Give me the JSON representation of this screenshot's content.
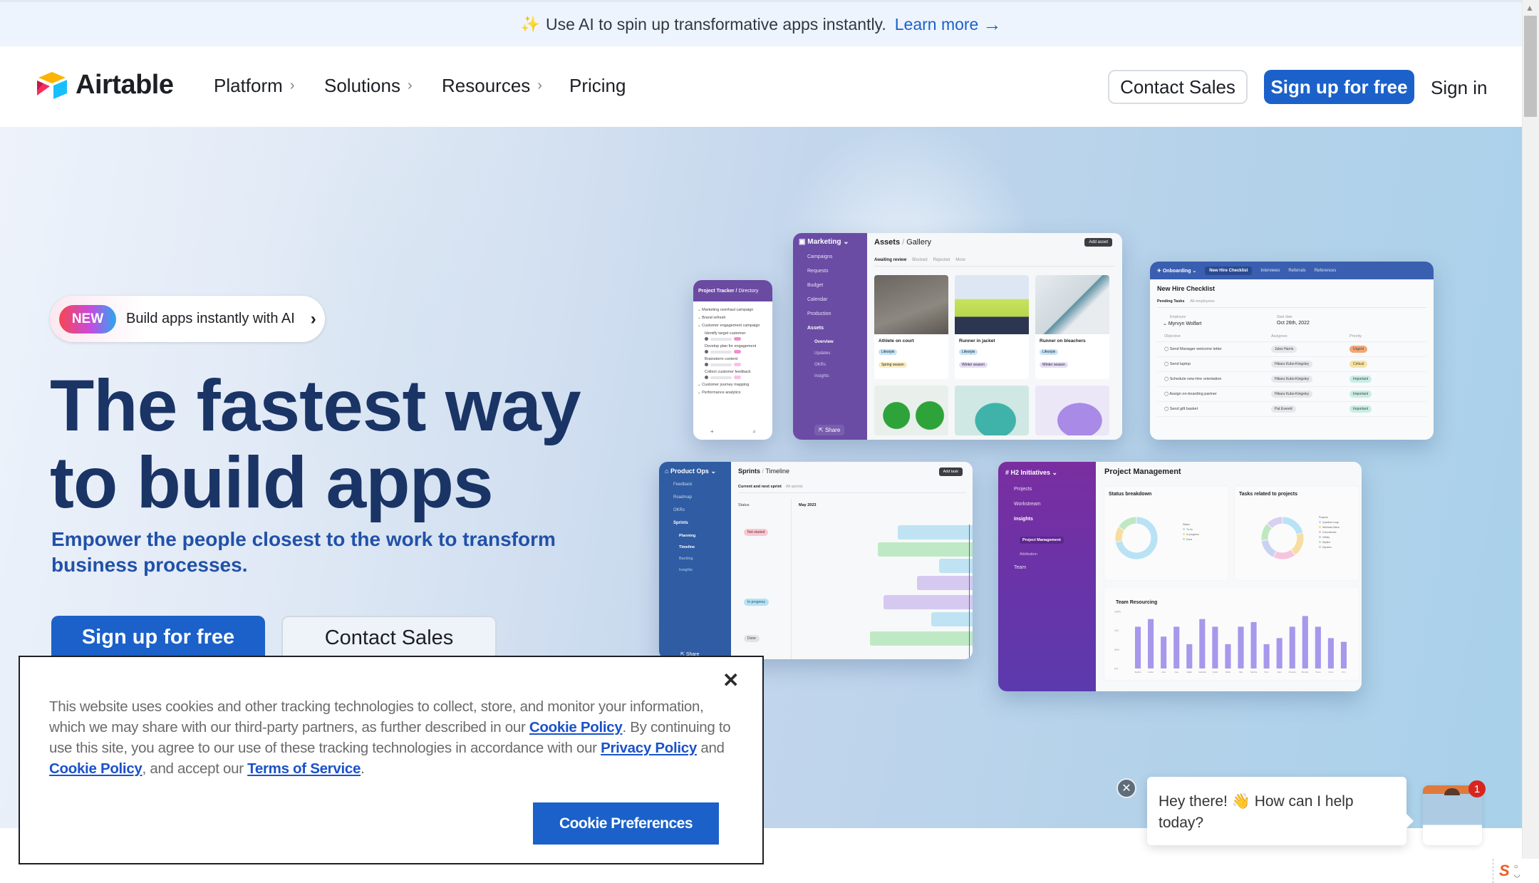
{
  "announcement": {
    "icon": "sparkles-icon",
    "text": "Use AI to spin up transformative apps instantly.",
    "link_label": "Learn more",
    "link_icon": "arrow-right-icon"
  },
  "nav": {
    "logo_text": "Airtable",
    "items": [
      {
        "label": "Platform",
        "has_chevron": true
      },
      {
        "label": "Solutions",
        "has_chevron": true
      },
      {
        "label": "Resources",
        "has_chevron": true
      },
      {
        "label": "Pricing",
        "has_chevron": false
      }
    ],
    "contact_sales": "Contact Sales",
    "sign_up": "Sign up for free",
    "sign_in": "Sign in"
  },
  "hero": {
    "badge": "NEW",
    "badge_text": "Build apps instantly with AI",
    "headline_line1": "The fastest way",
    "headline_line2": "to build apps",
    "subtitle": "Empower the people closest to the work to transform business processes.",
    "primary_cta": "Sign up for free",
    "secondary_cta": "Contact Sales"
  },
  "mockups": {
    "project_tracker": {
      "title": "Project Tracker",
      "subtitle": "Directory",
      "items": [
        "Marketing overhaul campaign",
        "Brand refresh",
        "Customer engagement campaign",
        "Identify target customer",
        "Develop plan for engagement",
        "Brainstorm content",
        "Collect customer feedback",
        "Customer journey mapping",
        "Performance analytics"
      ]
    },
    "marketing": {
      "app": "Marketing",
      "nav": [
        "Campaigns",
        "Requests",
        "Budget",
        "Calendar",
        "Production",
        "Assets"
      ],
      "subnav": [
        "Overview",
        "Updates",
        "OKRs",
        "Insights"
      ],
      "share": "Share",
      "crumb_a": "Assets",
      "crumb_b": "Gallery",
      "add_button": "Add asset",
      "tabs": [
        "Awaiting review",
        "Blocked",
        "Rejected",
        "More"
      ],
      "tiles": [
        {
          "name": "Athlete on court",
          "tag1": "Lifestyle",
          "tag2": "Spring season"
        },
        {
          "name": "Runner in jacket",
          "tag1": "Lifestyle",
          "tag2": "Winter season"
        },
        {
          "name": "Runner on bleachers",
          "tag1": "Lifestyle",
          "tag2": "Winter season"
        }
      ]
    },
    "onboarding": {
      "app": "Onboarding",
      "tabs": [
        "New Hire Checklist",
        "Interviews",
        "Referrals",
        "References"
      ],
      "title": "New Hire Checklist",
      "subtabs": [
        "Pending Tasks",
        "All employees"
      ],
      "employee_label": "Employee",
      "start_label": "Start date",
      "employee": "Myrvyn Wolfart",
      "start_date": "Oct 26th, 2022",
      "columns": [
        "Objective",
        "Assignee",
        "Priority"
      ],
      "rows": [
        {
          "objective": "Send Manager welcome letter",
          "assignee": "Jules Harris",
          "priority": "Urgent"
        },
        {
          "objective": "Send laptop",
          "assignee": "Hikaru Kubo-Kingsley",
          "priority": "Critical"
        },
        {
          "objective": "Schedule new-hire orientation",
          "assignee": "Hikaru Kubo-Kingsley",
          "priority": "Important"
        },
        {
          "objective": "Assign on-boarding partner",
          "assignee": "Hikaru Kubo-Kingsley",
          "priority": "Important"
        },
        {
          "objective": "Send gift basket",
          "assignee": "Pat Everett",
          "priority": "Important"
        }
      ],
      "priority_colors": {
        "Urgent": "#f3a676",
        "Critical": "#f8e3a1",
        "Important": "#c9ede5"
      }
    },
    "product_ops": {
      "app": "Product Ops",
      "nav": [
        "Feedback",
        "Roadmap",
        "OKRs",
        "Sprints"
      ],
      "subnav": [
        "Planning",
        "Timeline",
        "Backlog",
        "Insights"
      ],
      "share": "Share",
      "crumb_a": "Sprints",
      "crumb_b": "Timeline",
      "add_button": "Add task",
      "tabs": [
        "Current and next sprint",
        "All sprints"
      ],
      "status_label": "Status",
      "month": "May 2023",
      "groups": [
        "Not started",
        "In progress",
        "Done"
      ]
    },
    "h2": {
      "app": "H2 Initiatives",
      "nav": [
        "Projects",
        "Workstream",
        "Insights"
      ],
      "subnav": [
        "Project Management",
        "Attribution"
      ],
      "nav_last": "Team",
      "title": "Project Management",
      "panel1_title": "Status breakdown",
      "panel2_title": "Tasks related to projects",
      "panel3_title": "Team Resourcing"
    }
  },
  "chart_data": [
    {
      "type": "pie",
      "title": "Status breakdown",
      "legend_title": "Status",
      "labels": [
        "To do",
        "In progress",
        "Done"
      ],
      "values": [
        72,
        12,
        16
      ],
      "colors": [
        "#b9e2f5",
        "#f7dea0",
        "#bfe8c2"
      ]
    },
    {
      "type": "pie",
      "title": "Tasks related to projects",
      "legend_title": "Projects",
      "labels": [
        "Quantum Leap",
        "Wellness Wave",
        "Greenthumb",
        "Infinity",
        "Skyline",
        "Dynamo"
      ],
      "values": [
        21,
        19,
        17,
        16,
        14,
        13
      ],
      "colors": [
        "#b9e2f5",
        "#f7dea0",
        "#f7c4dd",
        "#c8d3f3",
        "#bfe8c2",
        "#d8cff2"
      ]
    },
    {
      "type": "bar",
      "title": "Team Resourcing",
      "categories": [
        "Sophie",
        "Andre",
        "Aria",
        "Asa",
        "Elijah",
        "Isabella",
        "Justin",
        "Malik",
        "Mia",
        "Sophia",
        "Finn",
        "Sam",
        "Cheerio",
        "Murphy",
        "Tomé",
        "Circe",
        "Kim"
      ],
      "values": [
        110,
        130,
        84,
        110,
        64,
        130,
        110,
        64,
        110,
        122,
        64,
        80,
        110,
        138,
        110,
        80,
        70
      ],
      "ylim": [
        0,
        150
      ],
      "yticks": [
        "0%",
        "50%",
        "100",
        "150%"
      ],
      "color": "#a798ec"
    }
  ],
  "cookie": {
    "text_1": "This website uses cookies and other tracking technologies to collect, store, and monitor your information, which we may share with our third-party partners, as further described in our ",
    "link_1": "Cookie Policy",
    "text_2": ". By continuing to use this site, you agree to our use of these tracking technologies in accordance with our ",
    "link_2": "Privacy Policy",
    "text_3": " and ",
    "link_3": "Cookie Policy",
    "text_4": ", and accept our ",
    "link_4": "Terms of Service",
    "text_5": ".",
    "button": "Cookie Preferences",
    "close": "✕"
  },
  "chat": {
    "message": "Hey there! 👋 How can I help today?",
    "badge_count": "1",
    "close": "✕"
  },
  "ime": {
    "logo": "S"
  },
  "colors": {
    "brand_blue": "#1b61c9",
    "headline": "#1a3466",
    "subtitle": "#2151a8"
  }
}
